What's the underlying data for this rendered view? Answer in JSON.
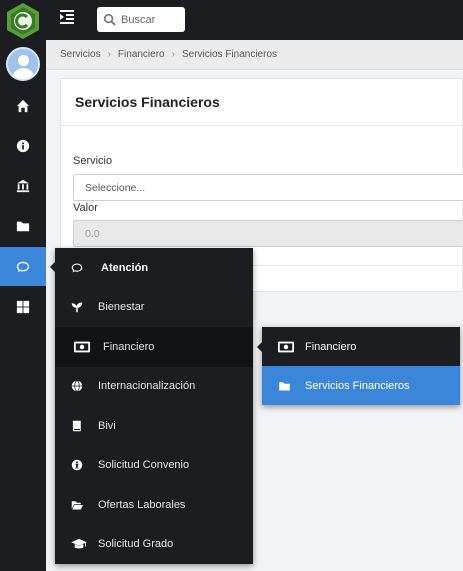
{
  "search": {
    "placeholder": "Buscar"
  },
  "breadcrumb": [
    "Servicios",
    "Financiero",
    "Servicios Financieros"
  ],
  "breadcrumb_separator": "›",
  "card": {
    "title": "Servicios Financieros",
    "servicio_label": "Servicio",
    "servicio_value": "Seleccione...",
    "valor_label": "Valor",
    "valor_value": "0.0"
  },
  "sidebar": {
    "icons": [
      "home-icon",
      "info-icon",
      "institution-icon",
      "folder-icon",
      "comments-icon",
      "windows-icon"
    ],
    "active": "comments-icon"
  },
  "menu": {
    "header": "Atención",
    "items": [
      "Bienestar",
      "Financiero",
      "Internacionalización",
      "Bivi",
      "Solicitud Convenio",
      "Ofertas Laborales",
      "Solicitud Grado"
    ],
    "selected": "Financiero"
  },
  "submenu": {
    "items": [
      "Financiero",
      "Servicios Financieros"
    ],
    "active": "Servicios Financieros"
  },
  "colors": {
    "sidebar": "#1c1d21",
    "accent": "#3b86d8",
    "logo_green": "#5a9e3a"
  }
}
